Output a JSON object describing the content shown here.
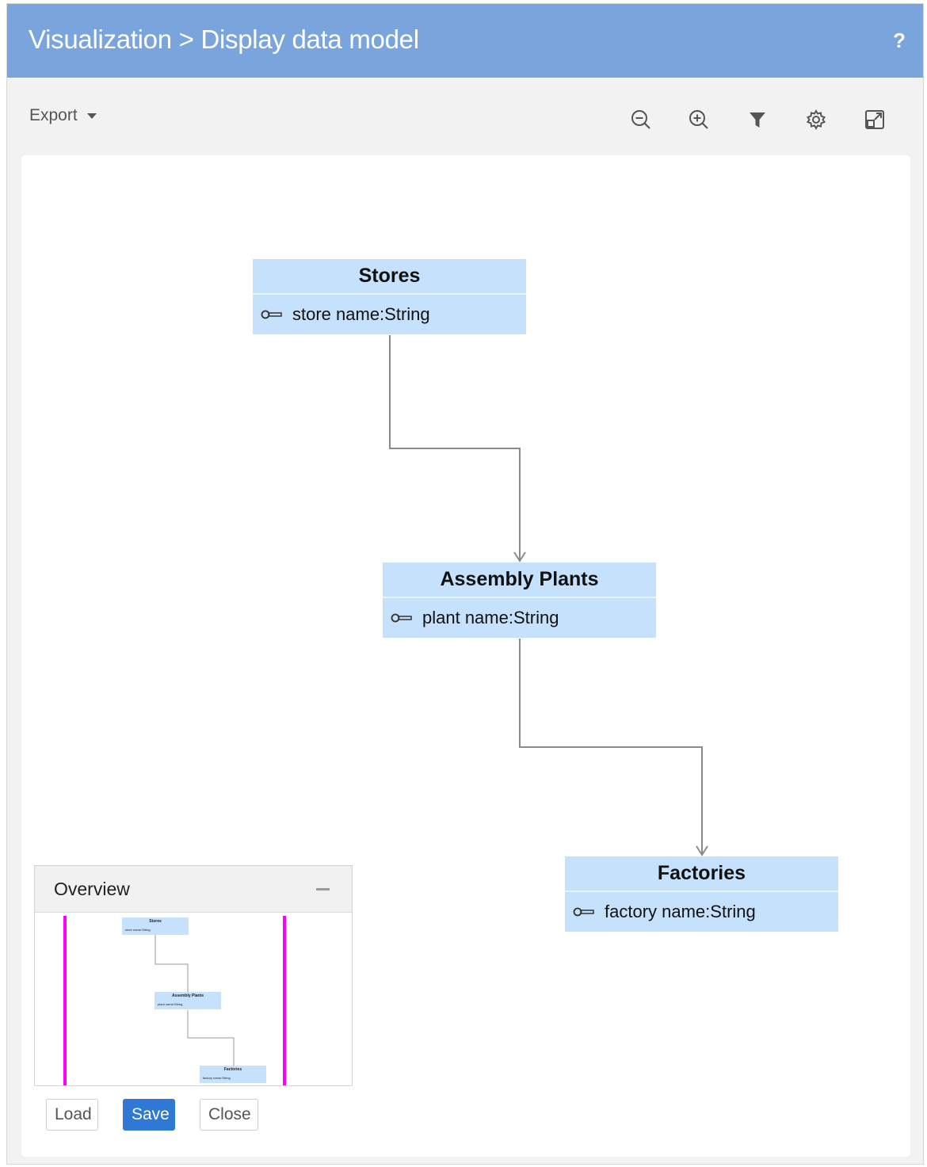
{
  "header": {
    "title": "Visualization > Display data model",
    "help_label": "?"
  },
  "toolbar": {
    "export_label": "Export",
    "icons": [
      "zoom-out-icon",
      "zoom-in-icon",
      "filter-icon",
      "settings-gear-icon",
      "expand-icon"
    ]
  },
  "diagram": {
    "entities": [
      {
        "name": "Stores",
        "attribute": "store name:String"
      },
      {
        "name": "Assembly Plants",
        "attribute": "plant name:String"
      },
      {
        "name": "Factories",
        "attribute": "factory name:String"
      }
    ]
  },
  "overview": {
    "title": "Overview",
    "viewport_color": "#ff00ff"
  },
  "footer": {
    "load_label": "Load",
    "save_label": "Save",
    "close_label": "Close"
  },
  "colors": {
    "header_bg": "#7aa5dc",
    "entity_bg": "#c5e1fb",
    "primary_button": "#2f78d4",
    "connector": "#8a8a8a"
  }
}
